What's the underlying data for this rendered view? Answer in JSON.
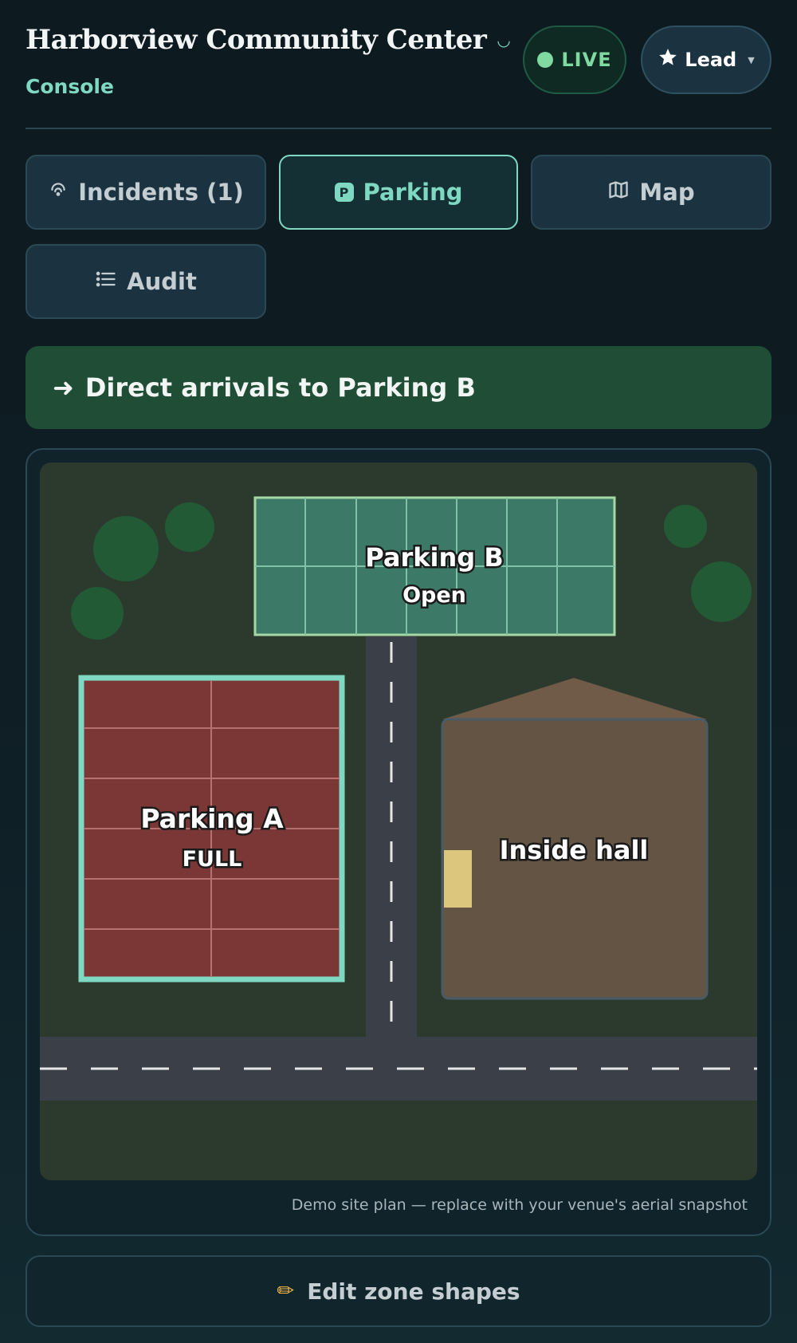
{
  "header": {
    "title": "Harborview Community Center",
    "subtitle": "Console",
    "live_label": "LIVE",
    "role_label": "Lead",
    "icons": {
      "title_icon": "smile-icon",
      "role_icon": "star-icon",
      "role_caret": "chevron-down-icon"
    }
  },
  "tabs": [
    {
      "label": "Incidents (1)",
      "icon": "signal-icon",
      "active": false
    },
    {
      "label": "Parking",
      "icon": "parking-icon",
      "active": true,
      "icon_text": "P"
    },
    {
      "label": "Map",
      "icon": "map-icon",
      "active": false
    },
    {
      "label": "Audit",
      "icon": "list-icon",
      "active": false
    }
  ],
  "banner": {
    "icon": "arrow-right-icon",
    "text": "Direct arrivals to Parking B"
  },
  "site_map": {
    "zones": {
      "parking_b": {
        "name": "Parking B",
        "status": "Open"
      },
      "parking_a": {
        "name": "Parking A",
        "status": "FULL"
      },
      "hall": {
        "name": "Inside hall"
      }
    },
    "caption": "Demo site plan — replace with your venue's aerial snapshot"
  },
  "edit_button": {
    "icon": "pencil-icon",
    "label": "Edit zone shapes"
  },
  "colors": {
    "accent": "#7fd9c2",
    "live": "#7fd9a0",
    "banner_bg": "#1f4d36",
    "zone_open": "#3c7a67",
    "zone_full": "#7b3735",
    "hall": "#635444"
  }
}
